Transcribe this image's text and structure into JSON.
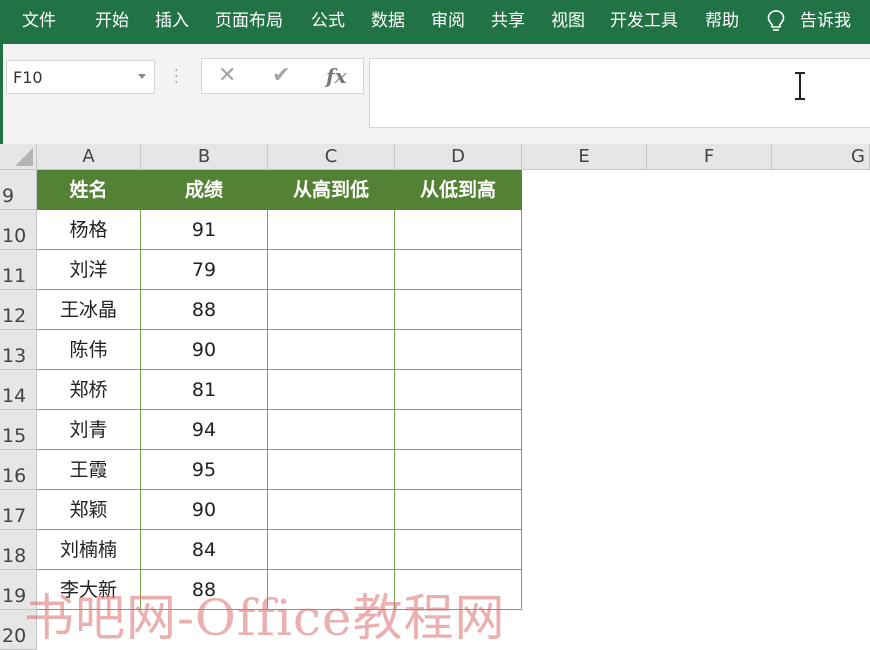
{
  "ribbon": {
    "tabs": [
      "文件",
      "开始",
      "插入",
      "页面布局",
      "公式",
      "数据",
      "审阅",
      "共享",
      "视图",
      "开发工具",
      "帮助"
    ],
    "tell_me_label": "告诉我",
    "tell_me_icon": "lightbulb-icon",
    "accent_color": "#217346"
  },
  "formula_bar": {
    "name_box_value": "F10",
    "cancel_icon": "✕",
    "enter_icon": "✔",
    "fx_label": "fx",
    "formula_value": ""
  },
  "sheet": {
    "columns": [
      "A",
      "B",
      "C",
      "D",
      "E",
      "F",
      "G"
    ],
    "row_numbers": [
      "9",
      "10",
      "11",
      "12",
      "13",
      "14",
      "15",
      "16",
      "17",
      "18",
      "19",
      "20"
    ],
    "table": {
      "header_color": "#548235",
      "headers": [
        "姓名",
        "成绩",
        "从高到低",
        "从低到高"
      ],
      "rows": [
        [
          "杨格",
          "91",
          "",
          ""
        ],
        [
          "刘洋",
          "79",
          "",
          ""
        ],
        [
          "王冰晶",
          "88",
          "",
          ""
        ],
        [
          "陈伟",
          "90",
          "",
          ""
        ],
        [
          "郑桥",
          "81",
          "",
          ""
        ],
        [
          "刘青",
          "94",
          "",
          ""
        ],
        [
          "王霞",
          "95",
          "",
          ""
        ],
        [
          "郑颖",
          "90",
          "",
          ""
        ],
        [
          "刘楠楠",
          "84",
          "",
          ""
        ],
        [
          "李大新",
          "88",
          "",
          ""
        ]
      ]
    }
  },
  "watermark": "书吧网-Office教程网"
}
